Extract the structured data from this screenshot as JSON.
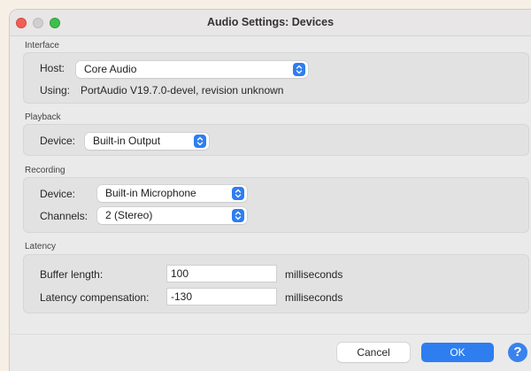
{
  "window": {
    "title": "Audio Settings: Devices"
  },
  "interface": {
    "section_label": "Interface",
    "host_label": "Host:",
    "host_value": "Core Audio",
    "using_label": "Using:",
    "using_value": "PortAudio V19.7.0-devel, revision unknown"
  },
  "playback": {
    "section_label": "Playback",
    "device_label": "Device:",
    "device_value": "Built-in Output"
  },
  "recording": {
    "section_label": "Recording",
    "device_label": "Device:",
    "device_value": "Built-in Microphone",
    "channels_label": "Channels:",
    "channels_value": "2 (Stereo)"
  },
  "latency": {
    "section_label": "Latency",
    "buffer_label": "Buffer length:",
    "buffer_value": "100",
    "buffer_unit": "milliseconds",
    "compensation_label": "Latency compensation:",
    "compensation_value": "-130",
    "compensation_unit": "milliseconds"
  },
  "footer": {
    "cancel_label": "Cancel",
    "ok_label": "OK",
    "help_label": "?"
  },
  "colors": {
    "accent": "#2e7ef0",
    "close": "#ee5f57",
    "zoom": "#3fbf4a"
  }
}
